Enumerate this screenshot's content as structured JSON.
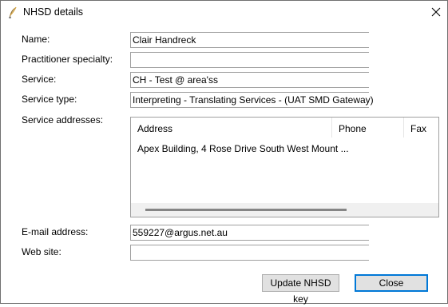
{
  "window": {
    "title": "NHSD details",
    "app_icon": "quill-icon",
    "close_icon": "close-icon"
  },
  "form": {
    "name_label": "Name:",
    "name_value": "Clair Handreck",
    "specialty_label": "Practitioner specialty:",
    "specialty_value": "",
    "service_label": "Service:",
    "service_value": "CH - Test @ area'ss",
    "service_type_label": "Service type:",
    "service_type_value": "Interpreting - Translating Services - (UAT SMD Gateway)",
    "addresses_label": "Service addresses:",
    "email_label": "E-mail address:",
    "email_value": "559227@argus.net.au",
    "website_label": "Web site:",
    "website_value": ""
  },
  "addresses": {
    "columns": [
      "Address",
      "Phone",
      "Fax"
    ],
    "rows": [
      {
        "address": "Apex Building, 4 Rose Drive South West Mount ...",
        "phone": "",
        "fax": ""
      }
    ]
  },
  "buttons": {
    "update": "Update NHSD key",
    "close": "Close"
  }
}
